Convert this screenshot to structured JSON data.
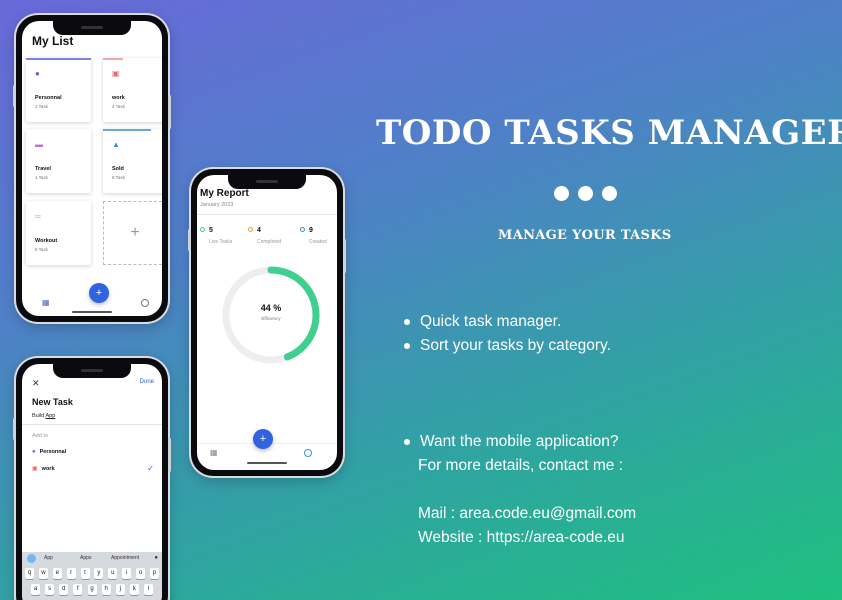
{
  "headline": "TODO TASKS MANAGER",
  "subheadline": "MANAGE YOUR TASKS",
  "features": [
    "Quick task manager.",
    "Sort your tasks by category."
  ],
  "contact": {
    "intro_line1": "Want the mobile application?",
    "intro_line2": "For more details, contact me :",
    "mail": "Mail : area.code.eu@gmail.com",
    "website": "Website : https://area-code.eu"
  },
  "my_list": {
    "title": "My List",
    "categories": [
      {
        "name": "Personnal",
        "count": "1 Task",
        "icon": "person-icon",
        "color": "#5b63d6"
      },
      {
        "name": "work",
        "count": "4 Task",
        "icon": "briefcase-icon",
        "color": "#e06a6a"
      },
      {
        "name": "Travel",
        "count": "1 Task",
        "icon": "car-icon",
        "color": "#c36ad8"
      },
      {
        "name": "Sold",
        "count": "8 Task",
        "icon": "cart-icon",
        "color": "#3a8fd6"
      },
      {
        "name": "Workout",
        "count": "8 Task",
        "icon": "dumbbell-icon",
        "color": "#e0a040"
      }
    ],
    "add_symbol": "+",
    "fab_symbol": "+"
  },
  "new_task": {
    "close_symbol": "✕",
    "done_label": "Done",
    "title": "New Task",
    "input_prefix": "Build ",
    "input_word": "App",
    "add_to_label": "Add to",
    "options": [
      {
        "name": "Personnal",
        "icon": "person-icon"
      },
      {
        "name": "work",
        "icon": "briefcase-icon",
        "selected": true
      }
    ],
    "check_symbol": "✓",
    "suggestions": [
      "App",
      "Apps",
      "Appointment"
    ],
    "keyboard_row1": [
      "q",
      "w",
      "e",
      "r",
      "t",
      "y",
      "u",
      "i",
      "o",
      "p"
    ],
    "keyboard_row2": [
      "a",
      "s",
      "d",
      "f",
      "g",
      "h",
      "j",
      "k",
      "l"
    ]
  },
  "report": {
    "title": "My Report",
    "month": "January 2023",
    "stats": [
      {
        "value": "5",
        "label": "Live Tasks",
        "color": "#3fcf8e"
      },
      {
        "value": "4",
        "label": "Completed",
        "color": "#f0a030"
      },
      {
        "value": "9",
        "label": "Created",
        "color": "#3a8fd6"
      }
    ],
    "efficiency_value": "44 %",
    "efficiency_label": "Efficiency",
    "efficiency_fraction": 0.44,
    "fab_symbol": "+"
  },
  "colors": {
    "accent": "#2f63df",
    "gauge": "#3fcf8e",
    "gauge_track": "#eeeeee"
  }
}
